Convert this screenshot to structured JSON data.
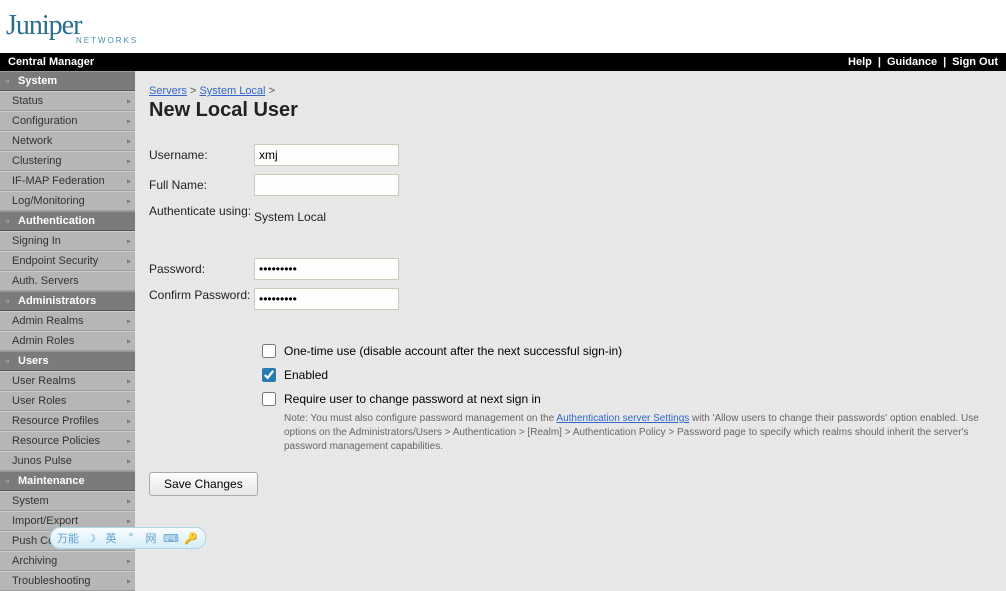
{
  "logo": {
    "brand": "Juniper",
    "sub": "NETWORKS"
  },
  "topbar": {
    "title": "Central Manager",
    "help": "Help",
    "guidance": "Guidance",
    "signout": "Sign Out"
  },
  "sidebar": {
    "sections": [
      {
        "title": "System",
        "items": [
          "Status",
          "Configuration",
          "Network",
          "Clustering",
          "IF-MAP Federation",
          "Log/Monitoring"
        ]
      },
      {
        "title": "Authentication",
        "items": [
          "Signing In",
          "Endpoint Security",
          "Auth. Servers"
        ]
      },
      {
        "title": "Administrators",
        "items": [
          "Admin Realms",
          "Admin Roles"
        ]
      },
      {
        "title": "Users",
        "items": [
          "User Realms",
          "User Roles",
          "Resource Profiles",
          "Resource Policies",
          "Junos Pulse"
        ]
      },
      {
        "title": "Maintenance",
        "items": [
          "System",
          "Import/Export",
          "Push Config",
          "Archiving",
          "Troubleshooting"
        ]
      }
    ]
  },
  "breadcrumb": {
    "servers": "Servers",
    "systemlocal": "System Local",
    "sep": ">"
  },
  "page_title": "New Local User",
  "form": {
    "username_label": "Username:",
    "username_value": "xmj",
    "fullname_label": "Full Name:",
    "fullname_value": "",
    "authusing_label": "Authenticate using:",
    "authusing_value": "System Local",
    "password_label": "Password:",
    "password_value": "•••••••••",
    "confirm_label": "Confirm Password:",
    "confirm_value": "•••••••••",
    "onetime_label": "One-time use (disable account after the next successful sign-in)",
    "onetime_checked": false,
    "enabled_label": "Enabled",
    "enabled_checked": true,
    "requirechange_label": "Require user to change password at next sign in",
    "requirechange_checked": false,
    "note_prefix": "Note: You must also configure password management on the ",
    "note_link": "Authentication server Settings",
    "note_suffix": " with 'Allow users to change their passwords' option enabled. Use options on the Administrators/Users > Authentication > [Realm] > Authentication Policy > Password page to specify which realms should inherit the server's password management capabilities.",
    "save_label": "Save Changes"
  },
  "toolbar": {
    "label": "万能",
    "icons": [
      "moon",
      "英",
      "star",
      "网",
      "keyboard",
      "key"
    ]
  }
}
